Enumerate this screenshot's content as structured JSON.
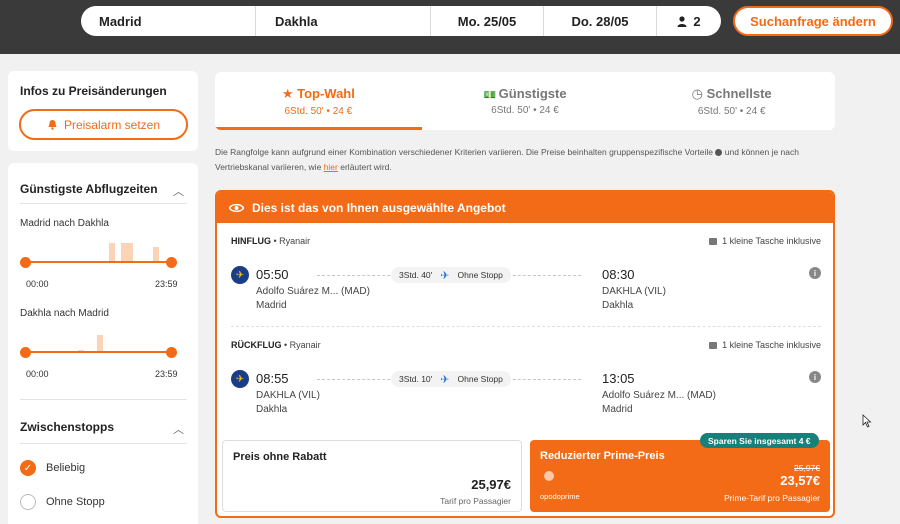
{
  "search": {
    "from": "Madrid",
    "to": "Dakhla",
    "date_out": "Mo. 25/05",
    "date_back": "Do. 28/05",
    "passengers": "2",
    "change_label": "Suchanfrage ändern"
  },
  "sidebar": {
    "alerts_title": "Infos zu Preisänderungen",
    "alarm_button": "Preisalarm setzen",
    "departure_title": "Günstigste Abflugzeiten",
    "route_out": "Madrid nach Dakhla",
    "route_back": "Dakhla nach Madrid",
    "time_start": "00:00",
    "time_end": "23:59",
    "stops_title": "Zwischenstopps",
    "stop_options": [
      "Beliebig",
      "Ohne Stopp"
    ]
  },
  "tabs": [
    {
      "label": "Top-Wahl",
      "sub": "6Std. 50' • 24 €",
      "icon": "star-icon"
    },
    {
      "label": "Günstigste",
      "sub": "6Std. 50' • 24 €",
      "icon": "money-icon"
    },
    {
      "label": "Schnellste",
      "sub": "6Std. 50' • 24 €",
      "icon": "clock-icon"
    }
  ],
  "disclaimer": {
    "text1": "Die Rangfolge kann aufgrund einer Kombination verschiedener Kriterien variieren. Die Preise beinhalten gruppenspezifische Vorteile",
    "text2": "und können je nach Vertriebskanal variieren, wie",
    "link": "hier",
    "text3": "erläutert wird."
  },
  "offer": {
    "header": "Dies ist das von Ihnen ausgewählte Angebot",
    "outbound": {
      "label": "HINFLUG",
      "airline": "Ryanair",
      "bag": "1 kleine Tasche inklusive",
      "dep_time": "05:50",
      "dep_airport": "Adolfo Suárez M... (MAD)",
      "dep_city": "Madrid",
      "duration": "3Std. 40'",
      "stops": "Ohne Stopp",
      "arr_time": "08:30",
      "arr_airport": "DAKHLA (VIL)",
      "arr_city": "Dakhla"
    },
    "inbound": {
      "label": "RÜCKFLUG",
      "airline": "Ryanair",
      "bag": "1 kleine Tasche inklusive",
      "dep_time": "08:55",
      "dep_airport": "DAKHLA (VIL)",
      "dep_city": "Dakhla",
      "duration": "3Std. 10'",
      "stops": "Ohne Stopp",
      "arr_time": "13:05",
      "arr_airport": "Adolfo Suárez M... (MAD)",
      "arr_city": "Madrid"
    },
    "price_regular": {
      "title": "Preis ohne Rabatt",
      "amount": "25,97€",
      "note": "Tarif pro Passagier"
    },
    "price_prime": {
      "title": "Reduzierter Prime-Preis",
      "old": "25,97€",
      "amount": "23,57€",
      "note": "Prime-Tarif pro Passagier",
      "brand": "opodoprime",
      "badge": "Sparen Sie insgesamt 4 €"
    }
  },
  "colors": {
    "accent": "#f36b16",
    "topbar": "#3a3a3a",
    "badge": "#18807a"
  }
}
